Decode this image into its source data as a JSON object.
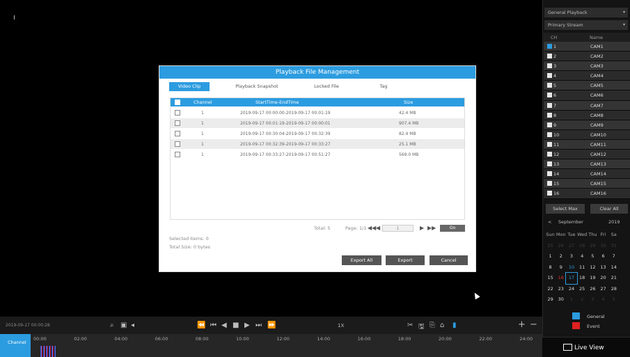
{
  "bottom_bar": {
    "timestamp": "2019-09-17 00:00:28",
    "speed": "1X",
    "plus": "+",
    "minus": "−"
  },
  "timeline": {
    "label": "Channel",
    "hours": [
      "00:00",
      "02:00",
      "04:00",
      "06:00",
      "08:00",
      "10:00",
      "12:00",
      "14:00",
      "16:00",
      "18:00",
      "20:00",
      "22:00",
      "24:00"
    ]
  },
  "right_panel": {
    "mode": "General Playback",
    "stream": "Primary Stream",
    "col_ch": "CH",
    "col_name": "Name",
    "channels": [
      {
        "id": "1",
        "name": "CAM1",
        "checked": true
      },
      {
        "id": "2",
        "name": "CAM2"
      },
      {
        "id": "3",
        "name": "CAM3"
      },
      {
        "id": "4",
        "name": "CAM4"
      },
      {
        "id": "5",
        "name": "CAM5"
      },
      {
        "id": "6",
        "name": "CAM6"
      },
      {
        "id": "7",
        "name": "CAM7"
      },
      {
        "id": "8",
        "name": "CAM8"
      },
      {
        "id": "9",
        "name": "CAM9"
      },
      {
        "id": "10",
        "name": "CAM10"
      },
      {
        "id": "11",
        "name": "CAM11"
      },
      {
        "id": "12",
        "name": "CAM12"
      },
      {
        "id": "13",
        "name": "CAM13"
      },
      {
        "id": "14",
        "name": "CAM14"
      },
      {
        "id": "15",
        "name": "CAM15"
      },
      {
        "id": "16",
        "name": "CAM16"
      }
    ],
    "select_max": "Select Max",
    "clear_all": "Clear All",
    "calendar": {
      "prev": "<",
      "month": "September",
      "year": "2019",
      "weekdays": [
        "Sun",
        "Mon",
        "Tue",
        "Wed",
        "Thu",
        "Fri",
        "Sa"
      ],
      "weeks": [
        [
          "25",
          "26",
          "27",
          "28",
          "29",
          "30",
          "31"
        ],
        [
          "1",
          "2",
          "3",
          "4",
          "5",
          "6",
          "7"
        ],
        [
          "8",
          "9",
          "10",
          "11",
          "12",
          "13",
          "14"
        ],
        [
          "15",
          "16",
          "17",
          "18",
          "19",
          "20",
          "21"
        ],
        [
          "22",
          "23",
          "24",
          "25",
          "26",
          "27",
          "28"
        ],
        [
          "29",
          "30",
          "1",
          "2",
          "3",
          "4",
          "5"
        ]
      ]
    },
    "legend": [
      {
        "label": "General",
        "color": "#2c9ce0"
      },
      {
        "label": "Event",
        "color": "#e02020"
      }
    ],
    "live_view": "Live View"
  },
  "dialog": {
    "title": "Playback File Management",
    "tabs": [
      "Video Clip",
      "Playback Snapshot",
      "Locked File",
      "Tag"
    ],
    "headers": {
      "channel": "Channel",
      "time": "StartTime-EndTime",
      "size": "Size"
    },
    "rows": [
      {
        "channel": "1",
        "time": "2019-09-17 00:00:00-2019-09-17 00:01:19",
        "size": "42.4 MB"
      },
      {
        "channel": "1",
        "time": "2019-09-17 00:01:19-2019-09-17 00:00:01",
        "size": "907.4 MB"
      },
      {
        "channel": "1",
        "time": "2019-09-17 00:30:04-2019-09-17 00:32:39",
        "size": "82.4 MB"
      },
      {
        "channel": "1",
        "time": "2019-09-17 00:32:39-2019-09-17 00:33:27",
        "size": "25.1 MB"
      },
      {
        "channel": "1",
        "time": "2019-09-17 00:33:27-2019-09-17 00:51:27",
        "size": "569.0 MB"
      }
    ],
    "total": "Total: 5",
    "page": "Page: 1/1",
    "page_input": "1",
    "go": "Go",
    "selected_items": "Selected Items: 0",
    "total_size": "Total Size: 0 bytes",
    "export_all": "Export All",
    "export": "Export",
    "cancel": "Cancel"
  }
}
